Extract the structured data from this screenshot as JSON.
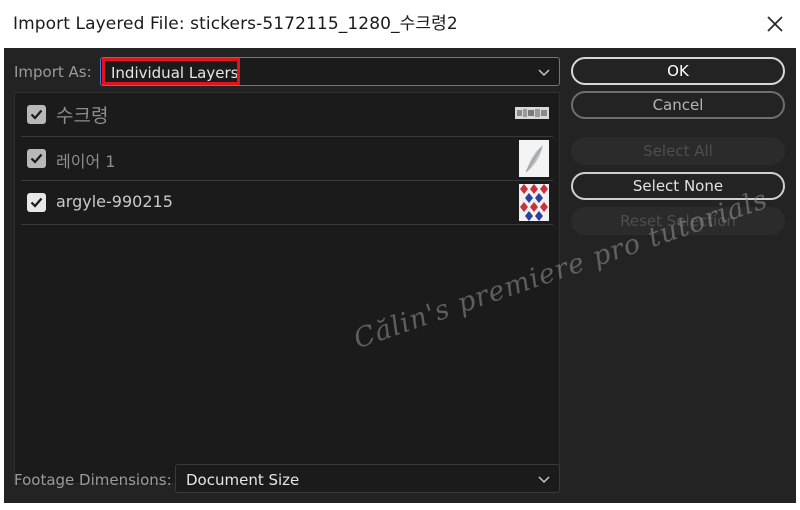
{
  "window": {
    "title": "Import Layered File: stickers-5172115_1280_수크령2"
  },
  "import_as": {
    "label": "Import As:",
    "value": "Individual Layers"
  },
  "layers": [
    {
      "name": "수크령",
      "checked": true,
      "thumbnail": "text-thumbnail"
    },
    {
      "name": "레이어 1",
      "checked": true,
      "thumbnail": "feather-thumbnail"
    },
    {
      "name": "argyle-990215",
      "checked": true,
      "thumbnail": "argyle-thumbnail"
    }
  ],
  "buttons": {
    "ok": "OK",
    "cancel": "Cancel",
    "select_all": "Select All",
    "select_none": "Select None",
    "reset_selection": "Reset Selection"
  },
  "footage": {
    "label": "Footage Dimensions:",
    "value": "Document Size"
  },
  "watermark": "Călin's premiere pro tutorials",
  "colors": {
    "dialog_bg": "#232323",
    "list_bg": "#1b1b1b",
    "focus_border": "#3b7fd6",
    "highlight": "#e1141c",
    "argyle_red": "#c8323c",
    "argyle_blue": "#2c3f9a"
  }
}
